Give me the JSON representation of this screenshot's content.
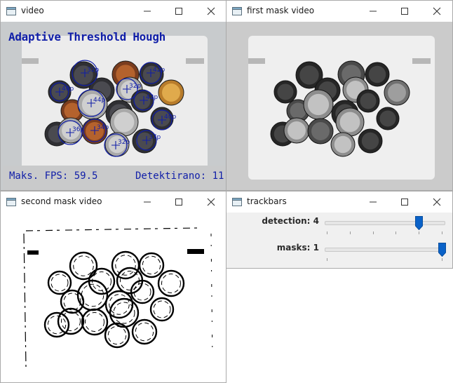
{
  "windows": {
    "video": {
      "title": "video",
      "overlay_title": "Adaptive Threshold Hough",
      "fps_label": "Maks. FPS: 59.5",
      "detected_label": "Detektirano: 11",
      "detection_labels": [
        "32p",
        "42p",
        "32p",
        "40p",
        "44p",
        "42p",
        "40p",
        "36p",
        "34p",
        "32p",
        "37p"
      ]
    },
    "first_mask": {
      "title": "first mask video"
    },
    "second_mask": {
      "title": "second mask video"
    },
    "trackbars": {
      "title": "trackbars",
      "sliders": [
        {
          "label": "detection: 4",
          "value": 4,
          "max": 5
        },
        {
          "label": "masks: 1",
          "value": 1,
          "max": 1
        }
      ]
    }
  },
  "colors": {
    "overlay_text": "#101ea8",
    "slider_thumb": "#0a62c8"
  }
}
